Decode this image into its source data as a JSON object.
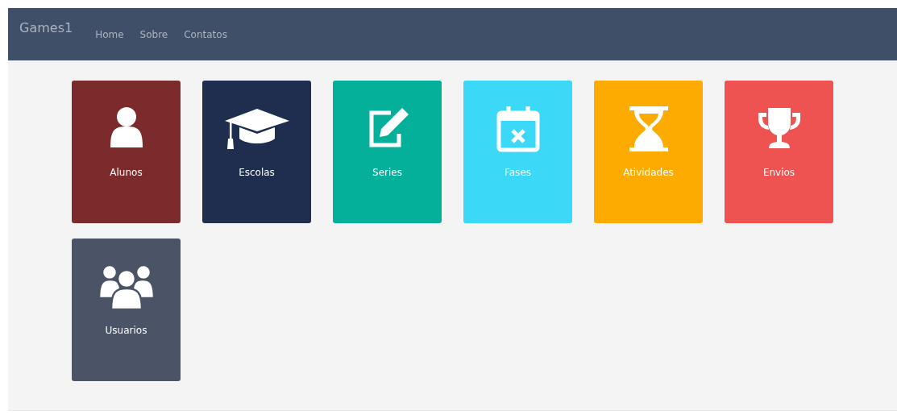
{
  "navbar": {
    "brand": "Games1",
    "links": [
      "Home",
      "Sobre",
      "Contatos"
    ]
  },
  "tiles": [
    {
      "label": "Alunos",
      "kind": "user",
      "color": "#7b2b2b"
    },
    {
      "label": "Escolas",
      "kind": "cap",
      "color": "#1f2e4e"
    },
    {
      "label": "Series",
      "kind": "edit",
      "color": "#05b09a"
    },
    {
      "label": "Fases",
      "kind": "calendar",
      "color": "#3bd8f7"
    },
    {
      "label": "Atividades",
      "kind": "hourglass",
      "color": "#fdab00"
    },
    {
      "label": "Envios",
      "kind": "trophy",
      "color": "#ee5351"
    },
    {
      "label": "Usuarios",
      "kind": "users",
      "color": "#4a5466"
    }
  ]
}
